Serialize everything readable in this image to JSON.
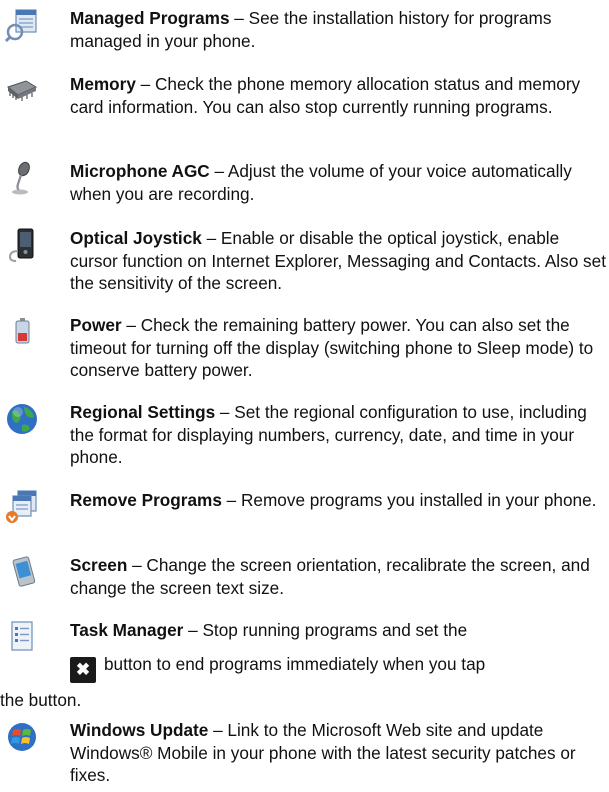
{
  "entries": [
    {
      "term": "Managed Programs",
      "desc": " – See the installation history for programs managed in your phone.",
      "icon": "managed-programs-icon"
    },
    {
      "term": "Memory",
      "desc": " – Check the phone memory allocation status and memory card information. You can also stop currently running programs.",
      "icon": "memory-chip-icon"
    },
    {
      "term": "Microphone AGC",
      "desc": " – Adjust the volume of your voice automatically when you are recording.",
      "icon": "microphone-icon"
    },
    {
      "term": "Optical Joystick",
      "desc": " – Enable or disable the optical joystick, enable cursor function on Internet Explorer, Messaging and Contacts. Also set the sensitivity of the screen.",
      "icon": "phone-joystick-icon"
    },
    {
      "term": "Power",
      "desc": " – Check the remaining battery power. You can also set the timeout for turning off the display (switching phone to Sleep mode) to conserve battery power.",
      "icon": "battery-icon"
    },
    {
      "term": "Regional Settings",
      "desc": " – Set the regional configuration to use, including the format for displaying numbers, currency, date, and time in your phone.",
      "icon": "globe-icon"
    },
    {
      "term": "Remove Programs",
      "desc": " – Remove programs you installed in your phone.",
      "icon": "remove-programs-icon"
    },
    {
      "term": "Screen",
      "desc": " – Change the screen orientation, recalibrate the screen, and change the screen text size.",
      "icon": "screen-icon"
    },
    {
      "term": "Windows Update",
      "desc": " – Link to the Microsoft Web site and update Windows® Mobile in your phone with the latest security patches or fixes.",
      "icon": "windows-update-icon"
    }
  ],
  "task_manager": {
    "term": "Task Manager",
    "line1_rest": " – Stop running programs and set the",
    "button_glyph": "✖",
    "line2": "button to end programs immediately when you tap",
    "line3": "the button.",
    "icon": "task-manager-icon"
  }
}
